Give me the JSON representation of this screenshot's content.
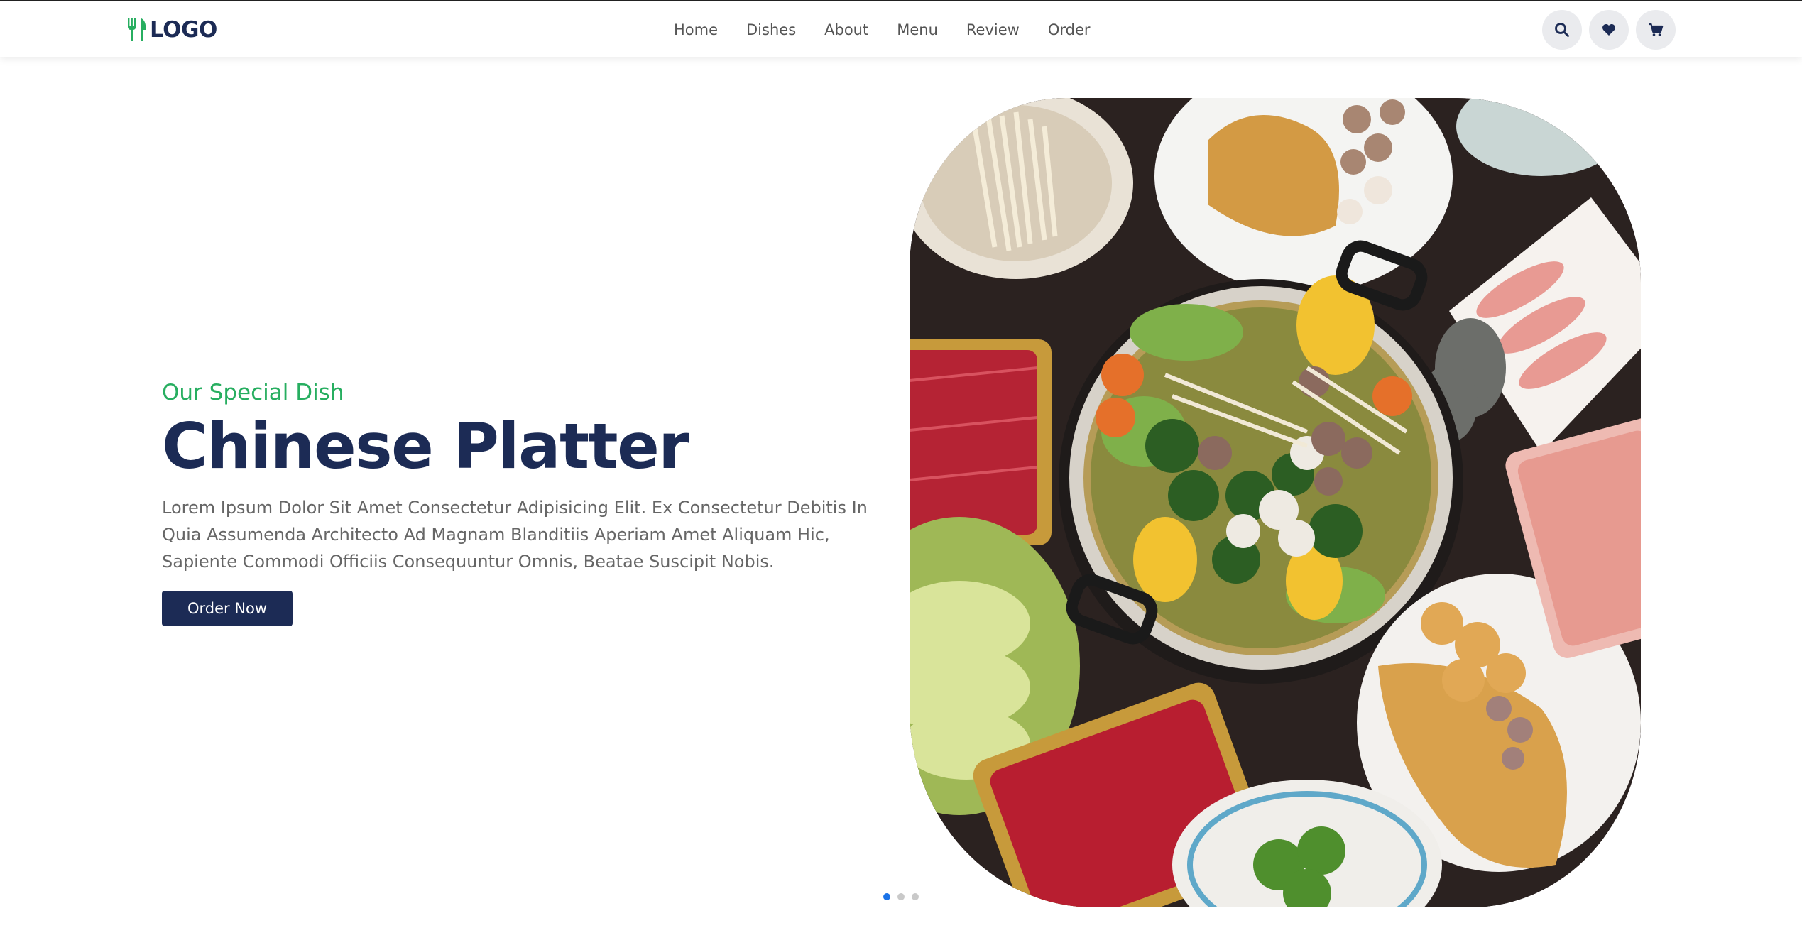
{
  "brand": {
    "logo_text": "LOGO",
    "logo_icon": "fork-knife-icon",
    "accent_color": "#27ae60",
    "primary_color": "#1c2b55"
  },
  "nav": {
    "items": [
      {
        "label": "Home"
      },
      {
        "label": "Dishes"
      },
      {
        "label": "About"
      },
      {
        "label": "Menu"
      },
      {
        "label": "Review"
      },
      {
        "label": "Order"
      }
    ]
  },
  "header_icons": [
    {
      "icon": "search-icon"
    },
    {
      "icon": "heart-icon"
    },
    {
      "icon": "cart-icon"
    }
  ],
  "hero": {
    "subtitle": "Our Special Dish",
    "title": "Chinese Platter",
    "description": "Lorem Ipsum Dolor Sit Amet Consectetur Adipisicing Elit. Ex Consectetur Debitis In Quia Assumenda Architecto Ad Magnam Blanditiis Aperiam Amet Aliquam Hic, Sapiente Commodi Officiis Consequuntur Omnis, Beatae Suscipit Nobis.",
    "cta_label": "Order Now"
  },
  "slider": {
    "count": 3,
    "active_index": 0
  }
}
